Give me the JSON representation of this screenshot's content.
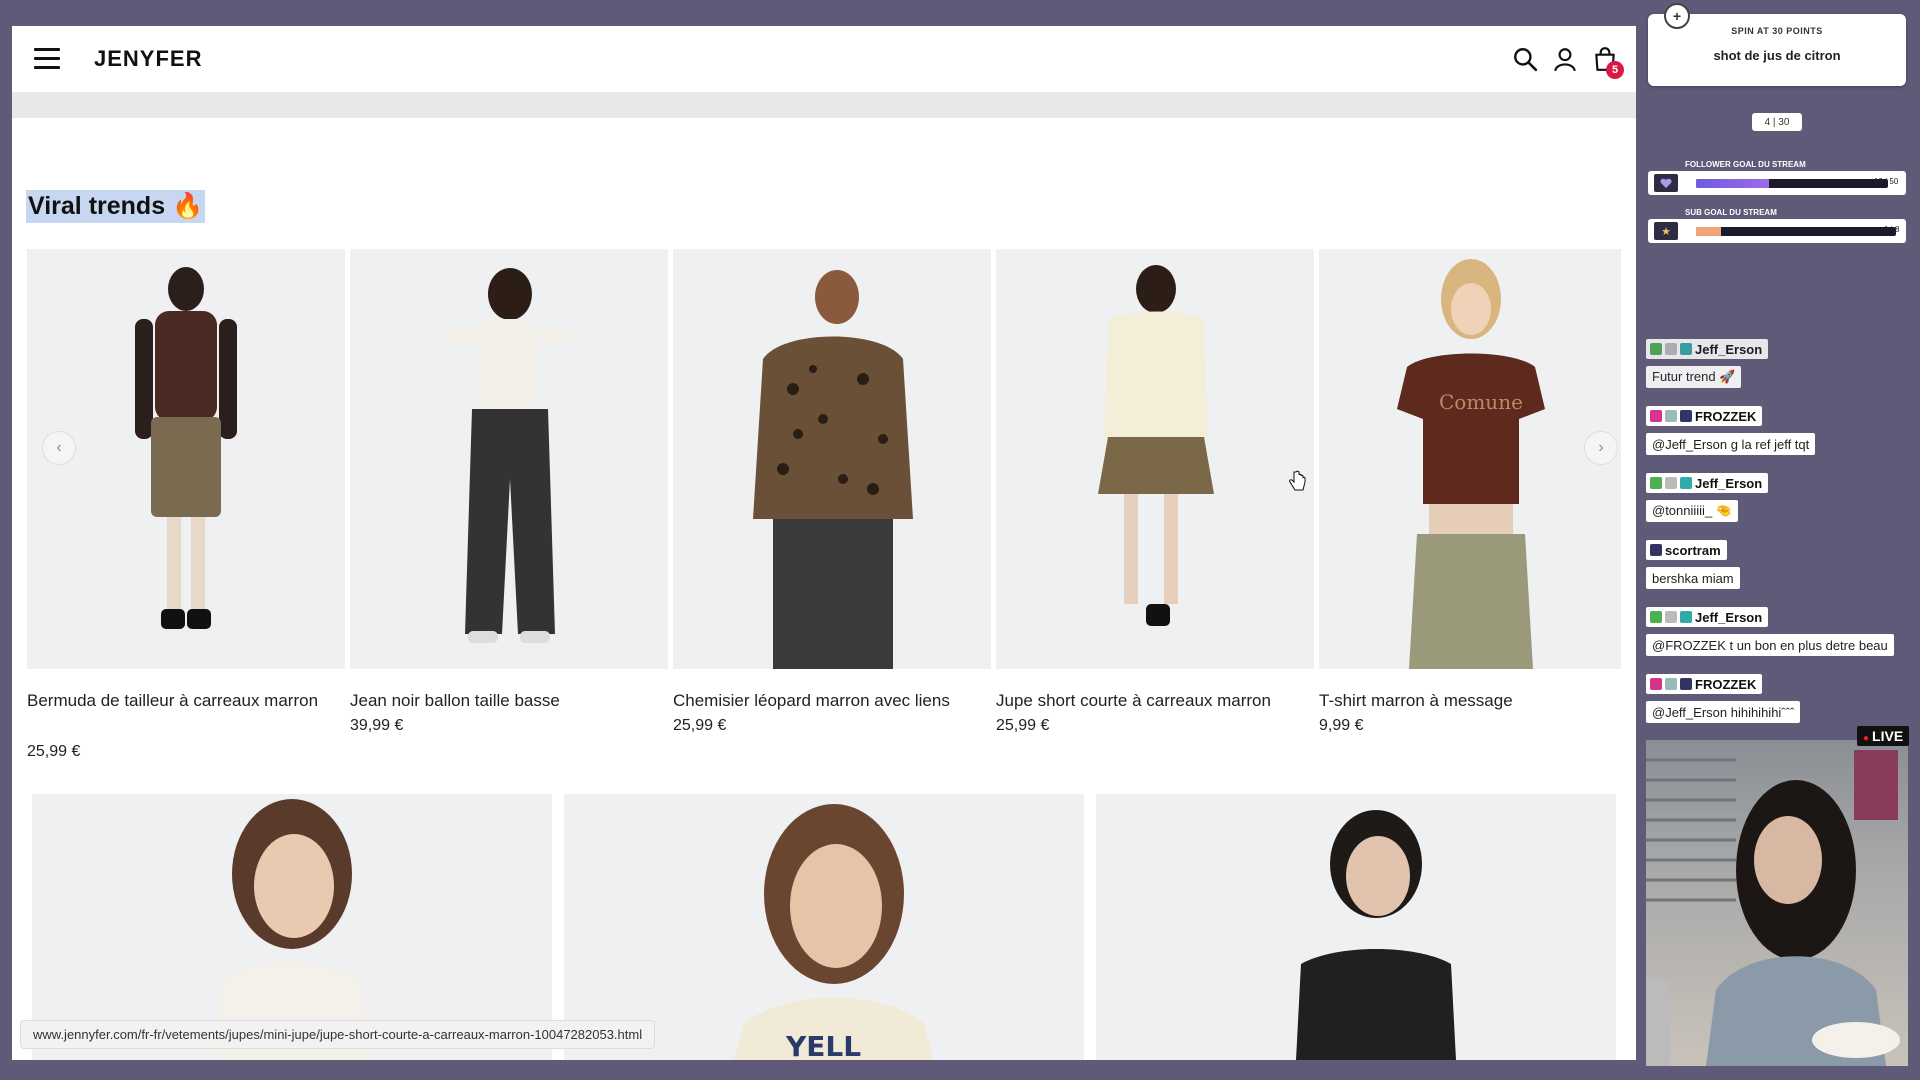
{
  "site": {
    "logo": "JENYFER",
    "cart_count": "5",
    "section_title": "Viral trends 🔥",
    "products": [
      {
        "name": "Bermuda de tailleur à carreaux marron",
        "price": "25,99 €"
      },
      {
        "name": "Jean noir ballon taille basse",
        "price": "39,99 €"
      },
      {
        "name": "Chemisier léopard marron avec liens",
        "price": "25,99 €"
      },
      {
        "name": "Jupe short courte à carreaux marron",
        "price": "25,99 €"
      },
      {
        "name": "T-shirt marron à message",
        "price": "9,99 €"
      }
    ],
    "carousel_prev": "‹",
    "carousel_next": "›",
    "status_url": "www.jennyfer.com/fr-fr/vetements/jupes/mini-jupe/jupe-short-courte-a-carreaux-marron-10047282053.html",
    "icons": [
      "menu-icon",
      "search-icon",
      "user-icon",
      "cart-icon"
    ]
  },
  "overlay": {
    "spin_title": "SPIN AT 30 POINTS",
    "spin_reward": "shot de jus de citron",
    "spin_count": "4 | 30",
    "follower_goal": {
      "label": "FOLLOWER GOAL DU STREAM",
      "value": "19 | 50",
      "progress": 0.38,
      "color": "#9b6be8"
    },
    "sub_goal": {
      "label": "SUB GOAL DU STREAM",
      "value": "1 | 8",
      "progress": 0.125,
      "color": "#f2a37a"
    },
    "live_label": "LIVE"
  },
  "chat": [
    {
      "user": "Jeff_Erson",
      "message": "Futur trend 🚀"
    },
    {
      "user": "FROZZEK",
      "message": "@Jeff_Erson g la ref jeff tqt"
    },
    {
      "user": "Jeff_Erson",
      "message": "@tonniiiii_ 🤏"
    },
    {
      "user": "scortram",
      "message": "bershka miam"
    },
    {
      "user": "Jeff_Erson",
      "message": "@FROZZEK t un bon en plus detre beau"
    },
    {
      "user": "FROZZEK",
      "message": "@Jeff_Erson hihihihihiˆˆˆ"
    }
  ]
}
